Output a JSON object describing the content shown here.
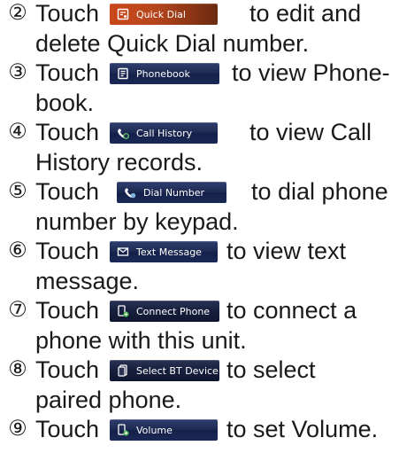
{
  "touch_word": "Touch",
  "colors": {
    "text": "#1a1a1a",
    "button_blue": "#1d2a52",
    "button_orange": "#c8481a",
    "button_text": "#ffffff"
  },
  "steps": [
    {
      "number": "②",
      "button_label": "Quick Dial",
      "button_icon": "quick-dial-icon",
      "after_text": "to edit and",
      "continuation": "delete Quick Dial number."
    },
    {
      "number": "③",
      "button_label": "Phonebook",
      "button_icon": "phonebook-icon",
      "after_text": "to view Phone-",
      "continuation": "book."
    },
    {
      "number": "④",
      "button_label": "Call History",
      "button_icon": "call-history-icon",
      "after_text": "to view Call",
      "continuation": "History records."
    },
    {
      "number": "⑤",
      "button_label": "Dial Number",
      "button_icon": "dial-number-icon",
      "after_text": "to dial phone",
      "continuation": "number by keypad."
    },
    {
      "number": "⑥",
      "button_label": "Text Message",
      "button_icon": "envelope-icon",
      "after_text": "to view text",
      "continuation": "message."
    },
    {
      "number": "⑦",
      "button_label": "Connect Phone",
      "button_icon": "connect-phone-icon",
      "after_text": "to connect a",
      "continuation": "phone with this unit."
    },
    {
      "number": "⑧",
      "button_label": "Select BT Device",
      "button_icon": "bt-device-icon",
      "after_text": "to select",
      "continuation": "paired phone."
    },
    {
      "number": "⑨",
      "button_label": "Volume",
      "button_icon": "volume-phone-icon",
      "after_text": "to set Volume.",
      "continuation": ""
    }
  ]
}
